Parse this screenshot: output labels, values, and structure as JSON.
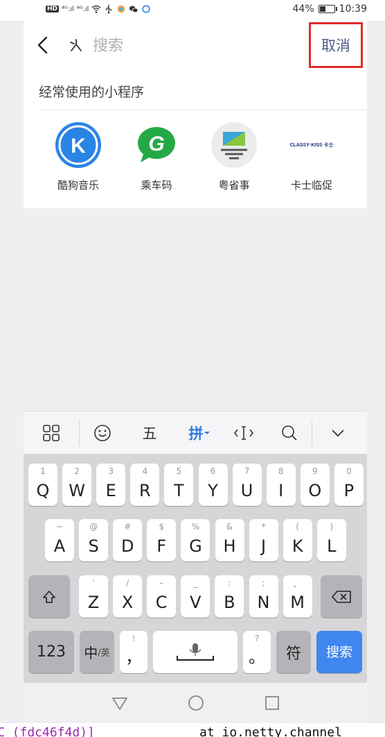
{
  "status_bar": {
    "hd_badge": "HD",
    "net1": "⁴ᴳ.ıl",
    "net2": "⁴ᴳ.ıl",
    "battery_text": "44%",
    "battery_level": 0.44,
    "time": "10:39"
  },
  "search": {
    "placeholder": "搜索",
    "cancel_label": "取消"
  },
  "recent": {
    "title": "经常使用的小程序",
    "apps": [
      {
        "label": "酷狗音乐",
        "icon": "kugou-logo-icon",
        "glyph": "K"
      },
      {
        "label": "乘车码",
        "icon": "transit-code-logo-icon",
        "glyph": "G"
      },
      {
        "label": "粤省事",
        "icon": "yueshengshi-logo-icon",
        "glyph": ""
      },
      {
        "label": "卡士临促",
        "icon": "classykiss-logo-icon",
        "logo_text": "CLASSY·KISS 卡士"
      }
    ]
  },
  "keyboard": {
    "toolbar": {
      "five": "五",
      "pinyin": "拼"
    },
    "row1": [
      {
        "main": "Q",
        "hint": "1"
      },
      {
        "main": "W",
        "hint": "2"
      },
      {
        "main": "E",
        "hint": "3"
      },
      {
        "main": "R",
        "hint": "4"
      },
      {
        "main": "T",
        "hint": "5"
      },
      {
        "main": "Y",
        "hint": "6"
      },
      {
        "main": "U",
        "hint": "7"
      },
      {
        "main": "I",
        "hint": "8"
      },
      {
        "main": "O",
        "hint": "9"
      },
      {
        "main": "P",
        "hint": "0"
      }
    ],
    "row2": [
      {
        "main": "A",
        "hint": "~"
      },
      {
        "main": "S",
        "hint": "@"
      },
      {
        "main": "D",
        "hint": "#"
      },
      {
        "main": "F",
        "hint": "$"
      },
      {
        "main": "G",
        "hint": "%"
      },
      {
        "main": "H",
        "hint": "&"
      },
      {
        "main": "J",
        "hint": "*"
      },
      {
        "main": "K",
        "hint": "("
      },
      {
        "main": "L",
        "hint": ")"
      }
    ],
    "row3": [
      {
        "main": "Z",
        "hint": "'"
      },
      {
        "main": "X",
        "hint": "/"
      },
      {
        "main": "C",
        "hint": "–"
      },
      {
        "main": "V",
        "hint": "_"
      },
      {
        "main": "B",
        "hint": ":"
      },
      {
        "main": "N",
        "hint": ";"
      },
      {
        "main": "M",
        "hint": "、"
      }
    ],
    "num_key": "123",
    "lang_key": "中",
    "lang_sub": "/英",
    "comma_key": "，",
    "comma_hint": "!",
    "period_key": "。",
    "period_hint": "?",
    "symbol_key": "符",
    "search_key": "搜索"
  },
  "terminal": {
    "left_text": "C (fdc46f4d)]",
    "right_text": "at io.netty.channel"
  }
}
